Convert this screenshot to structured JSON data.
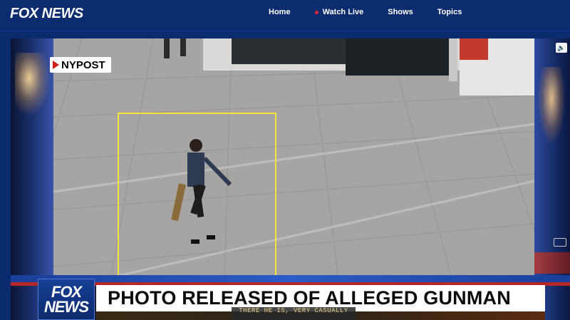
{
  "header": {
    "logo": "FOX NEWS",
    "nav": [
      {
        "label": "Home"
      },
      {
        "label": "Watch Live",
        "live": true
      },
      {
        "label": "Shows"
      },
      {
        "label": "Topics"
      }
    ]
  },
  "video": {
    "source_tag": "NYPOST",
    "mute_icon": "speaker-icon",
    "lower_third": {
      "logo_line1": "FOX",
      "logo_line2": "NEWS",
      "headline": "PHOTO RELEASED OF ALLEGED GUNMAN",
      "caption": "THERE HE IS, VERY CASUALLY"
    }
  },
  "colors": {
    "brand_blue": "#0b2c6f",
    "live_red": "#e4262f",
    "detection_box": "#f3e43a"
  }
}
